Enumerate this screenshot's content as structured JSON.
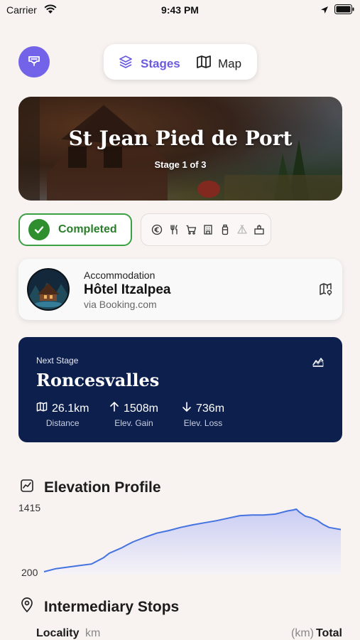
{
  "status_bar": {
    "carrier": "Carrier",
    "time": "9:43 PM"
  },
  "nav": {
    "segments": [
      {
        "label": "Stages",
        "icon": "layers-icon",
        "active": true
      },
      {
        "label": "Map",
        "icon": "map-icon",
        "active": false
      }
    ],
    "accent_color": "#6a5be0"
  },
  "hero": {
    "title": "St Jean Pied de Port",
    "subtitle": "Stage 1 of 3"
  },
  "status": {
    "completed_label": "Completed",
    "completed_color": "#2f8f2f",
    "amenities": [
      "euro-icon",
      "fork-knife-icon",
      "cart-icon",
      "building-icon",
      "bottle-icon",
      "tent-icon",
      "laundry-icon"
    ]
  },
  "accommodation": {
    "type": "Accommodation",
    "name": "Hôtel Itzalpea",
    "via": "via Booking.com"
  },
  "next_stage": {
    "label": "Next Stage",
    "name": "Roncesvalles",
    "background": "#0d1f4d",
    "stats": [
      {
        "icon": "map-icon",
        "value": "26.1km",
        "label": "Distance"
      },
      {
        "icon": "arrow-up-icon",
        "value": "1508m",
        "label": "Elev. Gain"
      },
      {
        "icon": "arrow-down-icon",
        "value": "736m",
        "label": "Elev. Loss"
      }
    ]
  },
  "elevation": {
    "title": "Elevation Profile",
    "max_label": "1415",
    "min_label": "200"
  },
  "chart_data": {
    "type": "area",
    "title": "Elevation Profile",
    "ylim": [
      200,
      1415
    ],
    "x": [
      0,
      0.04,
      0.08,
      0.12,
      0.16,
      0.2,
      0.22,
      0.24,
      0.26,
      0.28,
      0.3,
      0.34,
      0.38,
      0.42,
      0.46,
      0.5,
      0.54,
      0.58,
      0.62,
      0.66,
      0.7,
      0.74,
      0.78,
      0.8,
      0.82,
      0.84,
      0.85,
      0.86,
      0.87,
      0.88,
      0.9,
      0.92,
      0.94,
      0.96,
      0.98,
      1.0
    ],
    "values": [
      200,
      260,
      290,
      320,
      350,
      470,
      560,
      610,
      660,
      720,
      780,
      870,
      950,
      1000,
      1060,
      1110,
      1150,
      1190,
      1240,
      1290,
      1300,
      1300,
      1320,
      1350,
      1380,
      1400,
      1415,
      1360,
      1320,
      1280,
      1250,
      1200,
      1120,
      1060,
      1040,
      1020
    ]
  },
  "stops": {
    "title": "Intermediary Stops",
    "columns": {
      "locality": "Locality",
      "km": "km",
      "km_total": "(km)",
      "total": "Total"
    }
  }
}
